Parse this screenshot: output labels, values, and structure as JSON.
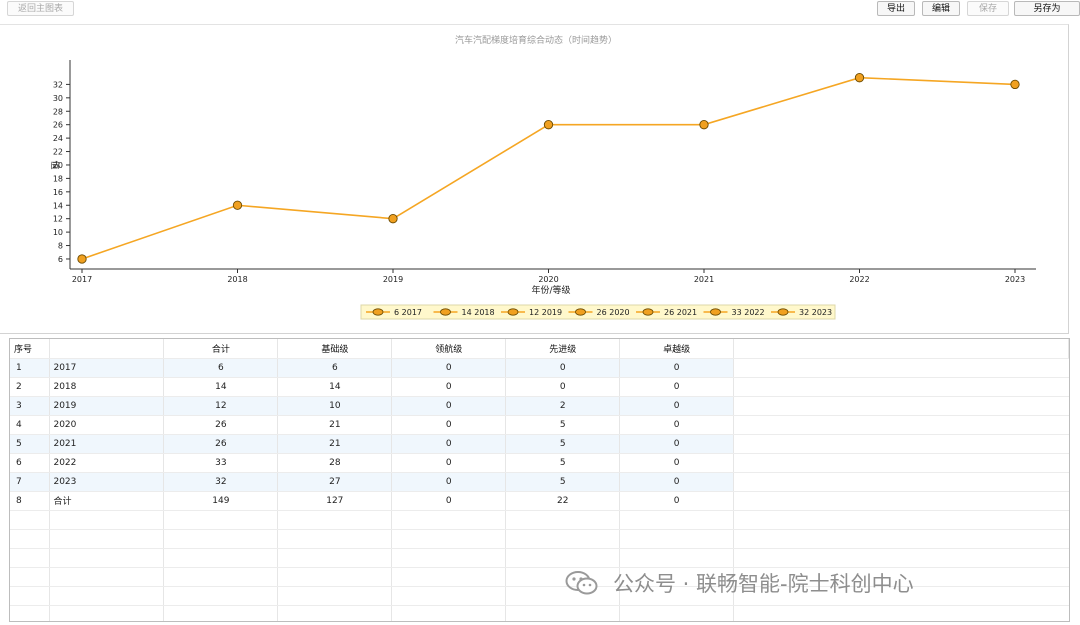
{
  "toolbar": {
    "back_label": "返回主图表",
    "export_label": "导出",
    "edit_label": "编辑",
    "save_label": "保存",
    "save_as_label": "另存为"
  },
  "chart_data": {
    "type": "line",
    "title": "汽车汽配梯度培育综合动态（时间趋势）",
    "xlabel": "年份/等级",
    "ylabel": "值",
    "x": [
      "2017",
      "2018",
      "2019",
      "2020",
      "2021",
      "2022",
      "2023"
    ],
    "values": [
      6,
      14,
      12,
      26,
      26,
      33,
      32
    ],
    "yticks": [
      6,
      8,
      10,
      12,
      14,
      16,
      18,
      20,
      22,
      24,
      26,
      28,
      30,
      32
    ],
    "ylim": [
      5.4,
      33.4
    ],
    "legend_position": "bottom",
    "legend": [
      "6 2017",
      "14 2018",
      "12 2019",
      "26 2020",
      "26 2021",
      "33 2022",
      "32 2023"
    ],
    "line_color": "#f5a623",
    "marker_color": "#f0a020",
    "grid": false
  },
  "table": {
    "headers": [
      "序号",
      "",
      "合计",
      "基础级",
      "领航级",
      "先进级",
      "卓越级"
    ],
    "rows": [
      [
        "1",
        "2017",
        "6",
        "6",
        "0",
        "0",
        "0"
      ],
      [
        "2",
        "2018",
        "14",
        "14",
        "0",
        "0",
        "0"
      ],
      [
        "3",
        "2019",
        "12",
        "10",
        "0",
        "2",
        "0"
      ],
      [
        "4",
        "2020",
        "26",
        "21",
        "0",
        "5",
        "0"
      ],
      [
        "5",
        "2021",
        "26",
        "21",
        "0",
        "5",
        "0"
      ],
      [
        "6",
        "2022",
        "33",
        "28",
        "0",
        "5",
        "0"
      ],
      [
        "7",
        "2023",
        "32",
        "27",
        "0",
        "5",
        "0"
      ],
      [
        "8",
        "合计",
        "149",
        "127",
        "0",
        "22",
        "0"
      ]
    ]
  },
  "watermark": {
    "text": "公众号 · 联畅智能-院士科创中心",
    "icon": "wechat-icon"
  }
}
